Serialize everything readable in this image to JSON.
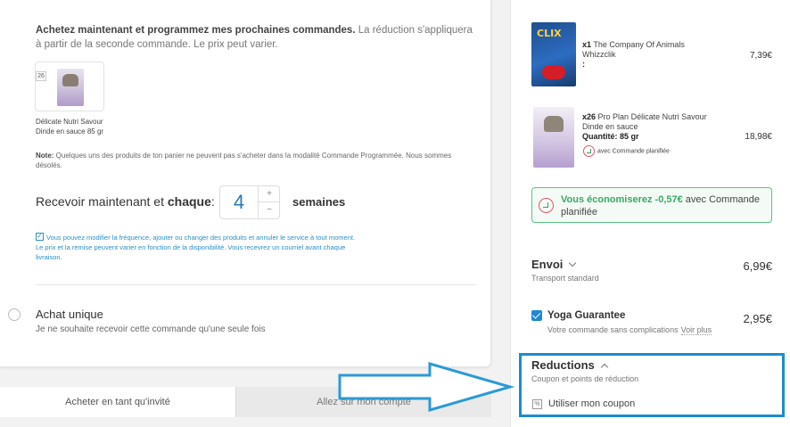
{
  "subscription": {
    "intro_bold": "Achetez maintenant et programmez mes prochaines commandes.",
    "intro_rest": " La réduction s'appliquera à partir de la seconde commande. Le prix peut varier.",
    "thumb_qty": "26",
    "thumb_caption": "Délicate Nutri Savour Dinde en sauce 85 gr",
    "note_label": "Note:",
    "note_text": " Quelques uns des produits de ton panier ne peuvent pas s'acheter dans la modalité Commande Programmée. Nous sommes désolés.",
    "recv_prefix": "Recevoir maintenant et ",
    "recv_bold": "chaque",
    "recv_colon": ":",
    "frequency_value": "4",
    "plus_label": "+",
    "minus_label": "−",
    "weeks_label": "semaines",
    "consent_text": "Vous pouvez modifier la fréquence, ajouter ou changer des produits et annuler le service à tout moment. Le prix et la remise peuvent varier en fonction de la disponibilité. Vous recevrez un courriel avant chaque livraison."
  },
  "unique": {
    "title": "Achat unique",
    "subtitle": "Je ne souhaite recevoir cette commande qu'une seule fois"
  },
  "tabs": {
    "guest": "Acheter en tant qu'invité",
    "account": "Allez sur mon compte"
  },
  "cart": {
    "items": [
      {
        "qty": "x1",
        "name": "The Company Of Animals Whizzclik",
        "extra": ":",
        "price": "7,39€",
        "image_text": "CLIX"
      },
      {
        "qty": "x26",
        "name": "Pro Plan Délicate Nutri Savour Dinde en sauce",
        "quantity_label": "Quantité: 85 gr",
        "schedule_label": "avec Commande planifiée",
        "price": "18,98€"
      }
    ],
    "savings_bold": "Vous économiserez -0,57€",
    "savings_rest": " avec Commande planifiée"
  },
  "shipping": {
    "title": "Envoi",
    "subtitle": "Transport standard",
    "price": "6,99€"
  },
  "yoga": {
    "title": "Yoga Guarantee",
    "subtitle": "Votre commande sans complications",
    "link": "Voir plus",
    "price": "2,95€"
  },
  "reductions": {
    "title": "Reductions",
    "subtitle": "Coupon et points de réduction",
    "coupon_icon": "%",
    "coupon_label": "Utiliser mon coupon"
  },
  "colors": {
    "accent_blue": "#1c8ccf",
    "savings_green": "#3aa866",
    "arrow_blue": "#2a9ad6"
  }
}
